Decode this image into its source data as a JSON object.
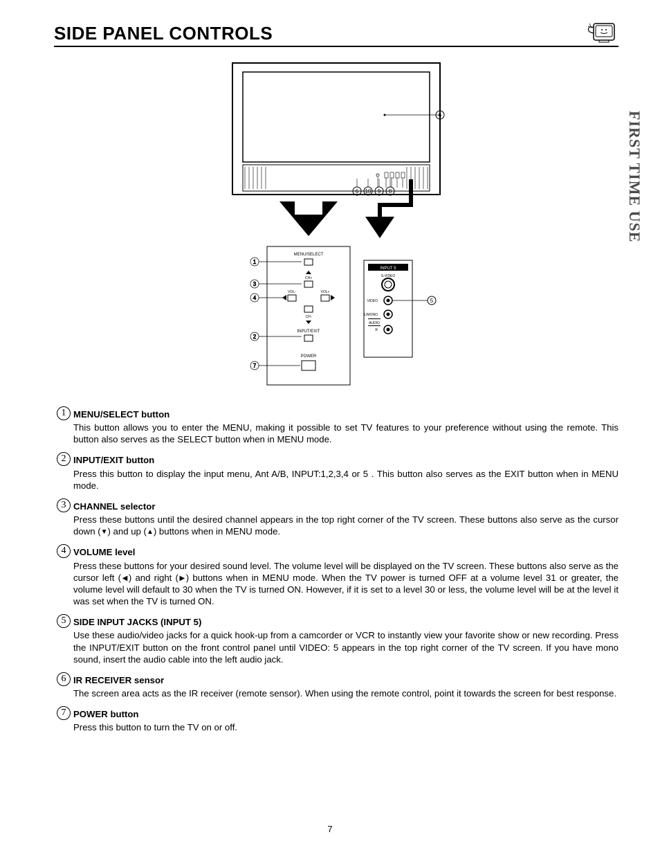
{
  "heading": "SIDE PANEL CONTROLS",
  "side_tab": "FIRST TIME USE",
  "page_number": "7",
  "diagram": {
    "labels": {
      "menu_select": "MENU/SELECT",
      "ch_up": "CH+",
      "ch_down": "CH-",
      "vol_minus": "VOL-",
      "vol_plus": "VOL+",
      "input_exit": "INPUT/EXIT",
      "power": "POWER",
      "input5": "INPUT 5",
      "s_video": "S-VIDEO",
      "video": "VIDEO",
      "l_mono": "L/MONO",
      "audio": "AUDIO",
      "r": "R"
    },
    "callouts": {
      "c1": "1",
      "c2": "2",
      "c3": "3",
      "c4": "4",
      "c5": "5",
      "c6": "6",
      "c7": "7",
      "c8": "8",
      "c9": "9",
      "c10": "10"
    }
  },
  "items": [
    {
      "num": "1",
      "title": "MENU/SELECT button",
      "desc": "This button allows you to enter the MENU, making it possible to set TV features to your preference without using the remote.  This button also serves as the SELECT button when in MENU mode."
    },
    {
      "num": "2",
      "title": "INPUT/EXIT button",
      "desc": "Press this button to display the input menu, Ant A/B, INPUT:1,2,3,4 or 5 .  This button also serves as the EXIT button when in MENU mode."
    },
    {
      "num": "3",
      "title": "CHANNEL selector",
      "desc_parts": [
        "Press these buttons until the desired channel appears in the top right corner of the TV screen.  These buttons also serve as the cursor down (",
        ") and up (",
        ") buttons when in MENU mode."
      ]
    },
    {
      "num": "4",
      "title": "VOLUME level",
      "desc_parts": [
        "Press these buttons for your desired sound level.  The volume level will be displayed on the TV screen.  These buttons also serve as the cursor left (",
        ") and right (",
        ") buttons when in MENU mode.  When the TV power is turned OFF at a volume level 31 or greater, the volume level will default to 30 when the TV is turned ON.  However, if it is set to a level 30 or less, the volume level will be at the level it was set when the TV is turned ON."
      ]
    },
    {
      "num": "5",
      "title": "SIDE INPUT JACKS (INPUT 5)",
      "desc": "Use these audio/video jacks for a quick hook-up from a camcorder or VCR to instantly view your favorite show or new recording.  Press the INPUT/EXIT button on the front control panel until VIDEO: 5 appears in the top right corner of the TV screen.  If you have mono sound, insert the audio cable into the left audio jack."
    },
    {
      "num": "6",
      "title": "IR RECEIVER sensor",
      "desc": "The screen area acts as the IR receiver (remote sensor).   When using the remote control, point it towards the screen for best response."
    },
    {
      "num": "7",
      "title": "POWER button",
      "desc": "Press this button to turn the TV on or off."
    }
  ]
}
